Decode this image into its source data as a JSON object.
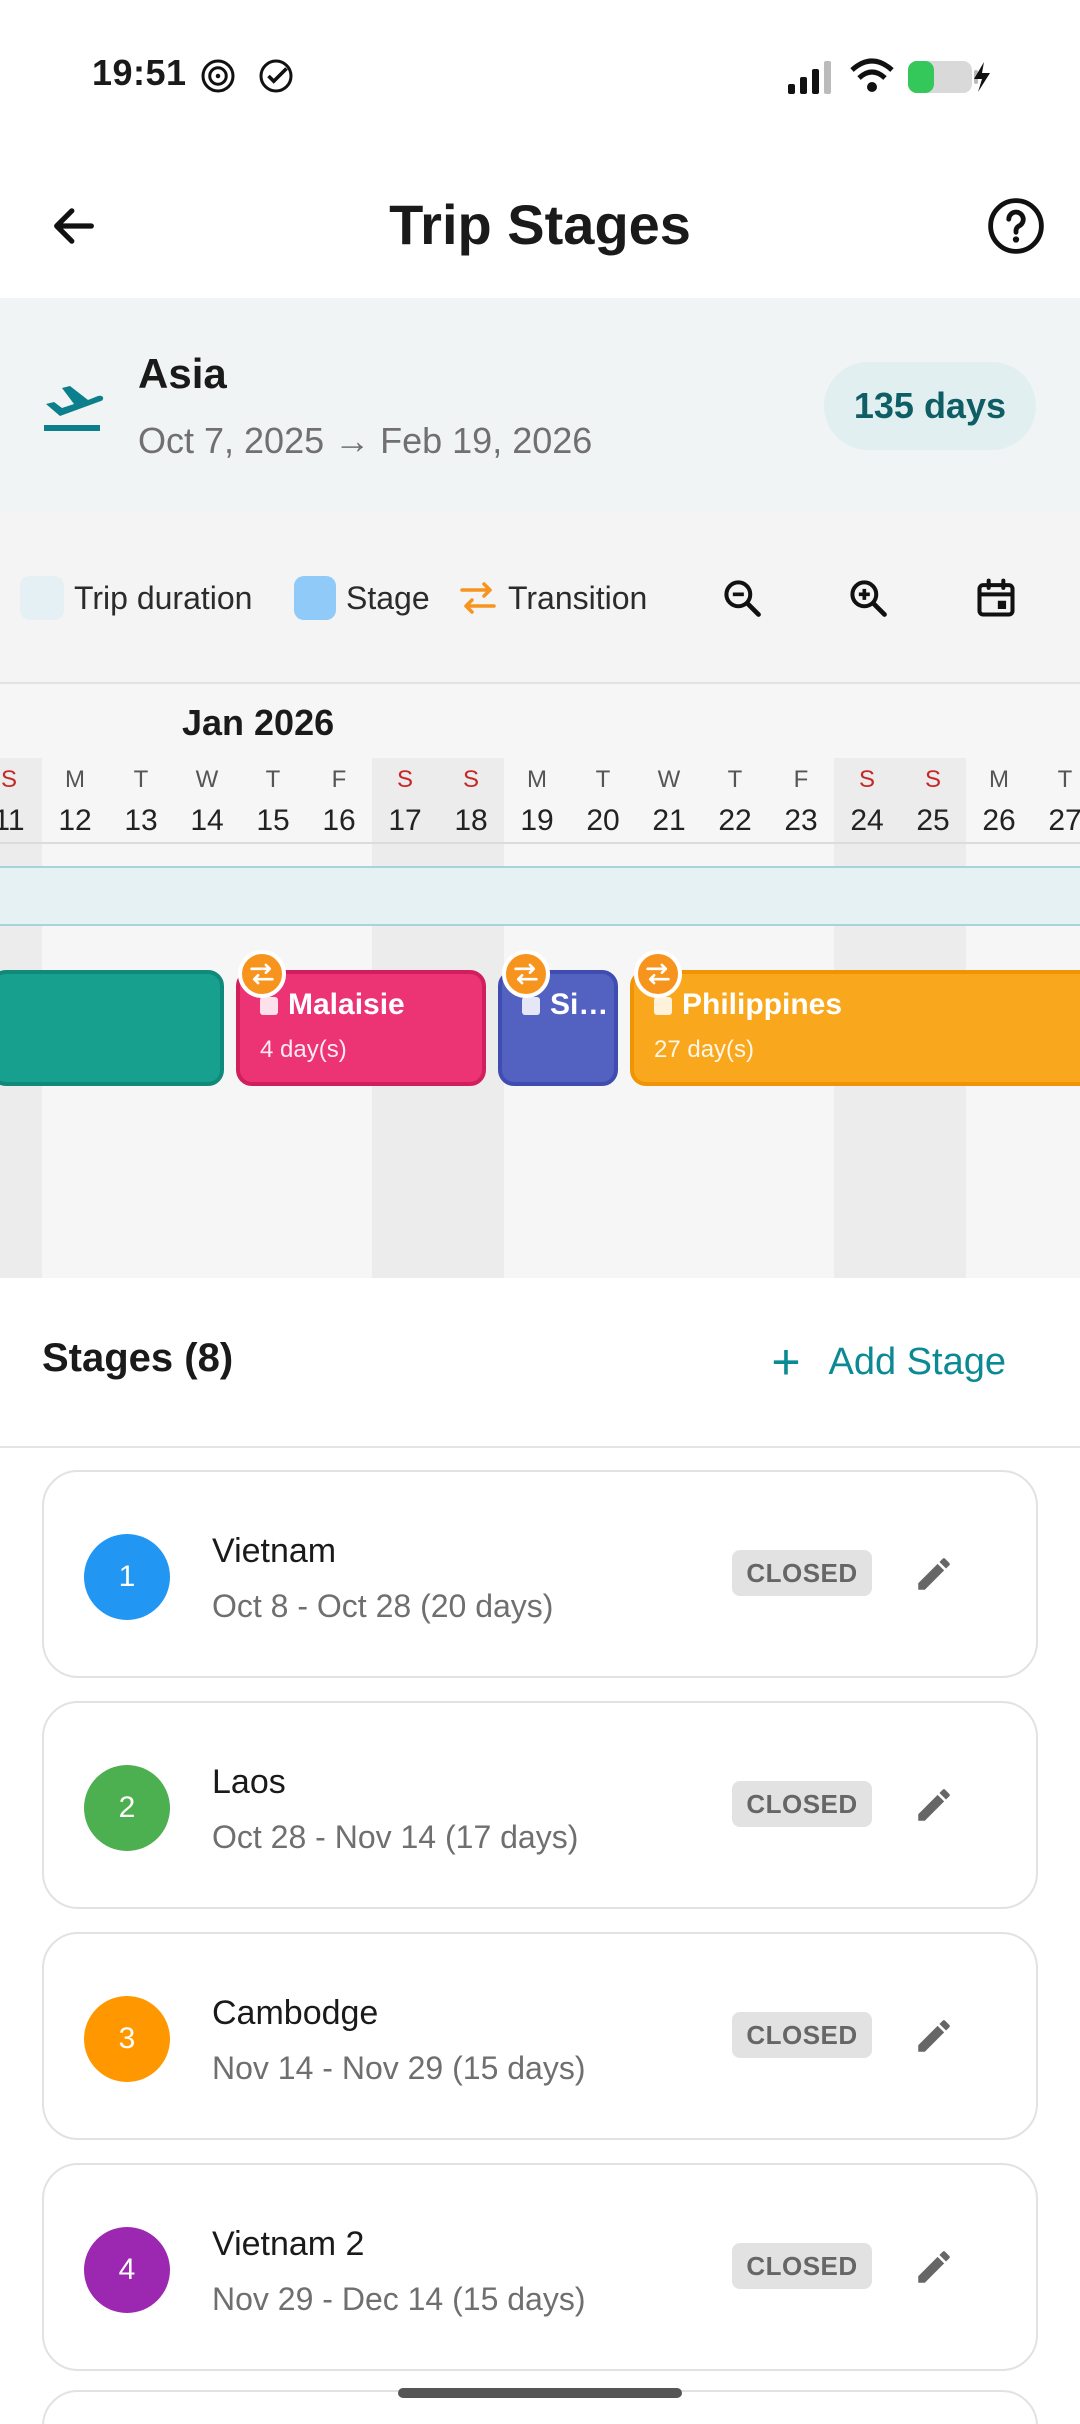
{
  "status_bar": {
    "time": "19:51"
  },
  "header": {
    "title": "Trip Stages"
  },
  "trip": {
    "name": "Asia",
    "dates": "Oct 7, 2025 → Feb 19, 2026",
    "duration": "135 days"
  },
  "legend": {
    "trip_duration": "Trip duration",
    "stage": "Stage",
    "transition": "Transition"
  },
  "timeline": {
    "month": "Jan 2026",
    "days": [
      {
        "letter": "S",
        "num": "11",
        "weekend": true
      },
      {
        "letter": "M",
        "num": "12",
        "weekend": false
      },
      {
        "letter": "T",
        "num": "13",
        "weekend": false
      },
      {
        "letter": "W",
        "num": "14",
        "weekend": false
      },
      {
        "letter": "T",
        "num": "15",
        "weekend": false
      },
      {
        "letter": "F",
        "num": "16",
        "weekend": false
      },
      {
        "letter": "S",
        "num": "17",
        "weekend": true
      },
      {
        "letter": "S",
        "num": "18",
        "weekend": true
      },
      {
        "letter": "M",
        "num": "19",
        "weekend": false
      },
      {
        "letter": "T",
        "num": "20",
        "weekend": false
      },
      {
        "letter": "W",
        "num": "21",
        "weekend": false
      },
      {
        "letter": "T",
        "num": "22",
        "weekend": false
      },
      {
        "letter": "F",
        "num": "23",
        "weekend": false
      },
      {
        "letter": "S",
        "num": "24",
        "weekend": true
      },
      {
        "letter": "S",
        "num": "25",
        "weekend": true
      },
      {
        "letter": "M",
        "num": "26",
        "weekend": false
      },
      {
        "letter": "T",
        "num": "27",
        "weekend": false
      }
    ],
    "stage_bars": [
      {
        "name": "",
        "days": "",
        "color": "#17a08e",
        "border": "#0f8a7a"
      },
      {
        "name": "Malaisie",
        "days": "4 day(s)",
        "color": "#ec3374",
        "border": "#d11f5e"
      },
      {
        "name": "Si…",
        "days": "",
        "color": "#5361c1",
        "border": "#3f4db0"
      },
      {
        "name": "Philippines",
        "days": "27 day(s)",
        "color": "#f9a71c",
        "border": "#f09405"
      }
    ]
  },
  "stages_section": {
    "title": "Stages (8)",
    "add_label": "Add Stage"
  },
  "stages": [
    {
      "num": "1",
      "name": "Vietnam",
      "dates": "Oct 8 - Oct 28 (20 days)",
      "status": "CLOSED",
      "color": "#2196f3"
    },
    {
      "num": "2",
      "name": "Laos",
      "dates": "Oct 28 - Nov 14 (17 days)",
      "status": "CLOSED",
      "color": "#4caf50"
    },
    {
      "num": "3",
      "name": "Cambodge",
      "dates": "Nov 14 - Nov 29 (15 days)",
      "status": "CLOSED",
      "color": "#ff9800"
    },
    {
      "num": "4",
      "name": "Vietnam 2",
      "dates": "Nov 29 - Dec 14 (15 days)",
      "status": "CLOSED",
      "color": "#9c27b0"
    }
  ]
}
